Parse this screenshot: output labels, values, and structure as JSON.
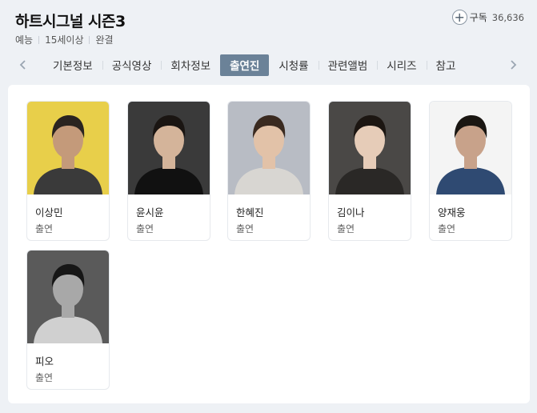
{
  "header": {
    "title": "하트시그널 시즌3",
    "meta": [
      "예능",
      "15세이상",
      "완결"
    ],
    "subscribe_label": "구독",
    "subscribe_count": "36,636"
  },
  "tabs": [
    {
      "label": "기본정보",
      "active": false
    },
    {
      "label": "공식영상",
      "active": false
    },
    {
      "label": "회차정보",
      "active": false
    },
    {
      "label": "출연진",
      "active": true
    },
    {
      "label": "시청률",
      "active": false
    },
    {
      "label": "관련앨범",
      "active": false
    },
    {
      "label": "시리즈",
      "active": false
    },
    {
      "label": "참고",
      "active": false
    }
  ],
  "cast": [
    {
      "name": "이상민",
      "role": "출연",
      "bg": "#e8cf4a",
      "shirt": "#3a3a3a",
      "skin": "#c49a7a",
      "hair": "#2a2420",
      "grayscale": false
    },
    {
      "name": "윤시윤",
      "role": "출연",
      "bg": "#3a3a3a",
      "shirt": "#111111",
      "skin": "#d4b49a",
      "hair": "#1a1512",
      "grayscale": false
    },
    {
      "name": "한혜진",
      "role": "출연",
      "bg": "#b8bcc4",
      "shirt": "#d8d6d2",
      "skin": "#e2c2a8",
      "hair": "#3a2a20",
      "grayscale": false
    },
    {
      "name": "김이나",
      "role": "출연",
      "bg": "#4a4846",
      "shirt": "#2a2826",
      "skin": "#e6ccb8",
      "hair": "#1c1612",
      "grayscale": false
    },
    {
      "name": "양재웅",
      "role": "출연",
      "bg": "#f4f4f4",
      "shirt": "#2f4a72",
      "skin": "#c8a28a",
      "hair": "#1a1612",
      "grayscale": false
    },
    {
      "name": "피오",
      "role": "출연",
      "bg": "#5a5a5a",
      "shirt": "#d0d0d0",
      "skin": "#a8a8a8",
      "hair": "#161616",
      "grayscale": true
    }
  ],
  "icons": {
    "prev": "chevron-left-icon",
    "next": "chevron-right-icon",
    "subscribe": "plus-icon"
  },
  "colors": {
    "active_tab": "#6b8298",
    "page_bg": "#eef1f5"
  }
}
